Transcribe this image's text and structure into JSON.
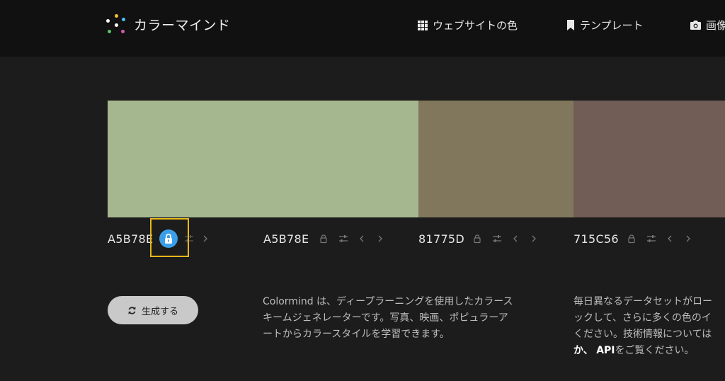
{
  "header": {
    "brand": "カラーマインド",
    "nav": [
      {
        "label": "ウェブサイトの色",
        "icon": "grid-icon"
      },
      {
        "label": "テンプレート",
        "icon": "bookmark-icon"
      },
      {
        "label": "画像",
        "icon": "camera-icon"
      }
    ]
  },
  "palette": [
    {
      "hex": "A5B78E",
      "color": "#A5B78E",
      "locked": true
    },
    {
      "hex": "A5B78E",
      "color": "#A5B78E",
      "locked": false
    },
    {
      "hex": "81775D",
      "color": "#81775D",
      "locked": false
    },
    {
      "hex": "715C56",
      "color": "#715C56",
      "locked": false
    }
  ],
  "generate": {
    "label": "生成する"
  },
  "description": {
    "lines": [
      "Colormind は、ディープラーニングを使用したカラース",
      "キームジェネレーターです。写真、映画、ポピュラーア",
      "ートからカラースタイルを学習できます。"
    ]
  },
  "info": {
    "lines": [
      "毎日異なるデータセットがロー",
      "ックして、さらに多くの色のイ",
      "ください。技術情報については"
    ],
    "line4_prefix": "か、",
    "api_link": "API",
    "line4_suffix": "をご覧ください。"
  },
  "colors": {
    "accent_lock": "#3b9ee8",
    "highlight": "#e8b71a",
    "background": "#1c1c1c",
    "header": "#111111"
  }
}
